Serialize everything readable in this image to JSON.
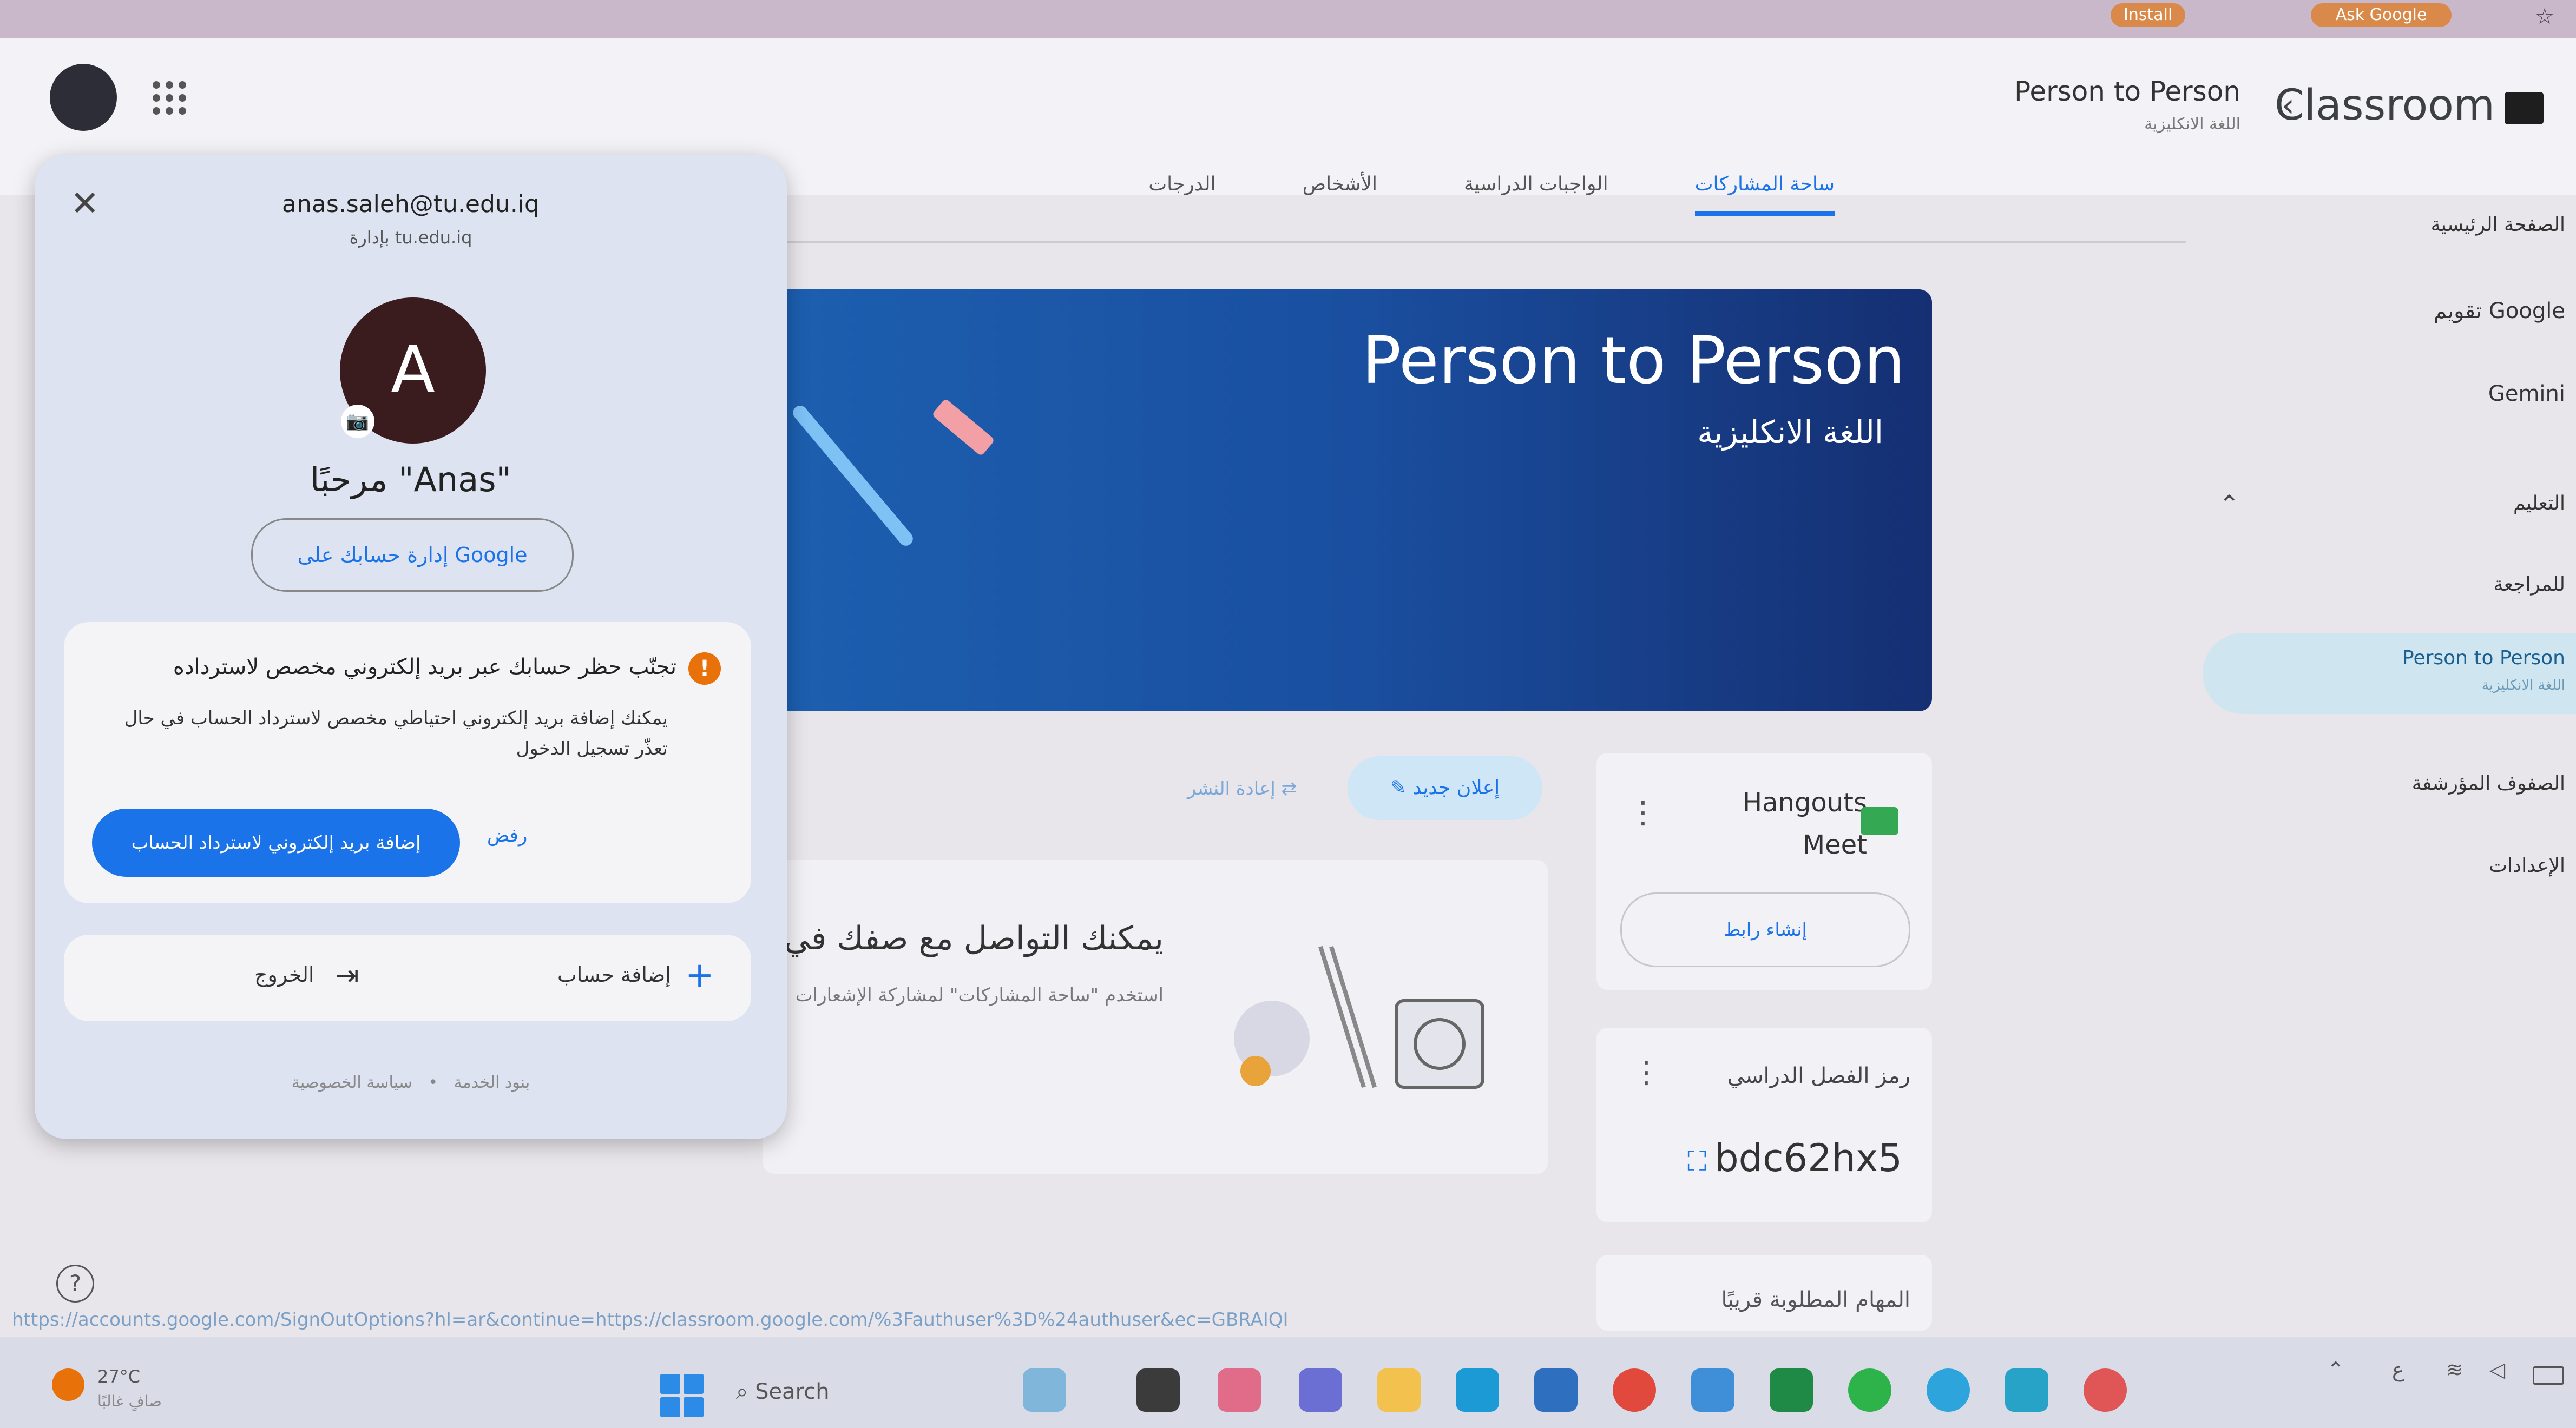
{
  "browser": {
    "install_label": "Install",
    "ask_google_label": "Ask Google",
    "status_url": "https://accounts.google.com/SignOutOptions?hl=ar&continue=https://classroom.google.com/%3Fauthuser%3D%24authuser&ec=GBRAIQI"
  },
  "header": {
    "app_name": "Classroom",
    "class_name": "Person to Person",
    "class_section": "اللغة الانكليزية"
  },
  "tabs": [
    {
      "label": "ساحة المشاركات",
      "active": true
    },
    {
      "label": "الواجبات الدراسية",
      "active": false
    },
    {
      "label": "الأشخاص",
      "active": false
    },
    {
      "label": "الدرجات",
      "active": false
    }
  ],
  "sidebar": {
    "items": [
      {
        "label": "الصفحة الرئيسية"
      },
      {
        "label": "تقويم Google"
      },
      {
        "label": "Gemini"
      },
      {
        "label": "التعليم"
      },
      {
        "label": "للمراجعة"
      },
      {
        "label": "Person to Person",
        "sub": "اللغة الانكليزية"
      },
      {
        "label": "الصفوف المؤرشفة"
      },
      {
        "label": "الإعدادات"
      }
    ]
  },
  "banner": {
    "title": "Person to Person",
    "subtitle": "اللغة الانكليزية"
  },
  "stream": {
    "announce_label": "إعلان جديد",
    "repost_label": "إعادة النشر",
    "feed_title": "يمكنك التواصل مع صفك في هـ",
    "feed_sub": "استخدم \"ساحة المشاركات\" لمشاركة الإشعارات"
  },
  "meet_card": {
    "title_line1": "Hangouts",
    "title_line2": "Meet",
    "create_link_label": "إنشاء رابط"
  },
  "code_card": {
    "label": "رمز الفصل الدراسي",
    "code": "bdc62hx5"
  },
  "upcoming": {
    "label": "المهام المطلوبة قريبًا"
  },
  "account_popup": {
    "email": "anas.saleh@tu.edu.iq",
    "org": "بإدارة tu.edu.iq",
    "avatar_letter": "A",
    "greeting": "مرحبًا \"Anas\"",
    "manage_label": "إدارة حسابك على Google",
    "warning_title": "تجنّب حظر حسابك عبر بريد إلكتروني مخصص لاسترداده",
    "warning_body": "يمكنك إضافة بريد إلكتروني احتياطي مخصص لاسترداد الحساب في حال تعذّر تسجيل الدخول",
    "add_recovery_label": "إضافة بريد إلكتروني لاسترداد الحساب",
    "dismiss_label": "رفض",
    "add_account_label": "إضافة حساب",
    "sign_out_label": "الخروج",
    "privacy_label": "سياسة الخصوصية",
    "terms_label": "بنود الخدمة",
    "separator": "•"
  },
  "taskbar": {
    "temperature": "27°C",
    "weather_text": "صافٍ غالبًا",
    "search_label": "Search",
    "tray_lang": "ع"
  },
  "colors": {
    "accent": "#1a73e8",
    "banner": "#1a4fa0",
    "warning": "#e8710a"
  }
}
